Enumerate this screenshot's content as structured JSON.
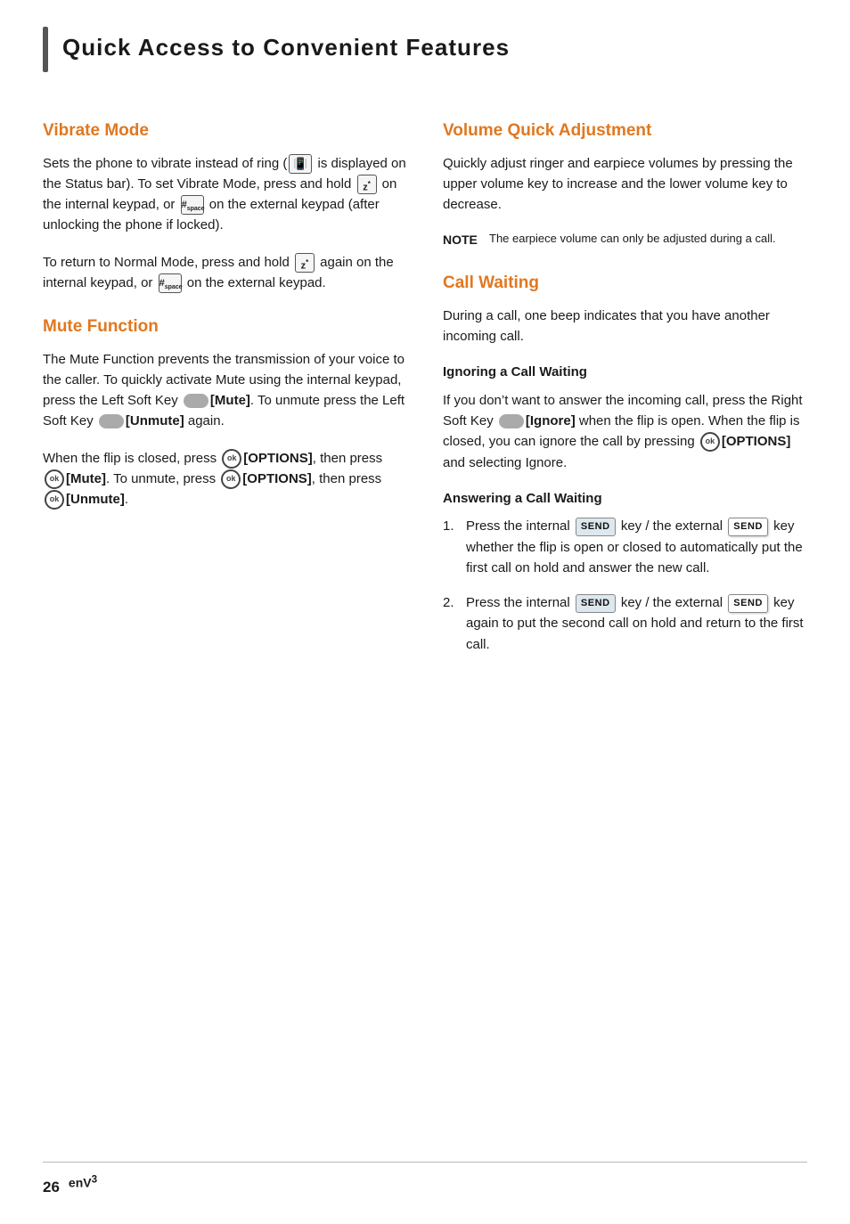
{
  "page": {
    "title": "Quick Access to Convenient Features",
    "accent_bar_visible": true
  },
  "left_col": {
    "vibrate_mode": {
      "title": "Vibrate Mode",
      "body1": "Sets the phone to vibrate instead of ring (",
      "body1b": " is displayed on the Status bar). To set Vibrate Mode, press and hold ",
      "body1c": " on the internal keypad, or ",
      "body1d": " on the external keypad (after unlocking the phone if locked).",
      "body2": "To return to Normal Mode, press and hold ",
      "body2b": " again on the internal keypad, or ",
      "body2c": " on the external keypad."
    },
    "mute_function": {
      "title": "Mute Function",
      "body1": "The Mute Function prevents the transmission of your voice to the caller. To quickly activate Mute using the internal keypad, press the Left Soft Key ",
      "mute_label": "[Mute]",
      "body2": ". To unmute press the Left Soft Key ",
      "unmute_label": "[Unmute]",
      "body3": " again.",
      "body4": "When the flip is closed, press ",
      "options_label": "[OPTIONS]",
      "body5": ", then press ",
      "mute_label2": "[Mute]",
      "body6": ". To unmute, press ",
      "options_label2": "[OPTIONS]",
      "body7": ", then press ",
      "unmute_label2": "[Unmute]",
      "body8": "."
    }
  },
  "right_col": {
    "volume_quick": {
      "title": "Volume Quick Adjustment",
      "body": "Quickly adjust ringer and earpiece volumes by pressing the upper volume key to increase and the lower volume key to decrease.",
      "note_label": "NOTE",
      "note_text": "The earpiece volume can only be adjusted during a call."
    },
    "call_waiting": {
      "title": "Call Waiting",
      "body": "During a call, one beep indicates that you have another incoming call.",
      "ignoring": {
        "title": "Ignoring a Call Waiting",
        "body1": "If you don’t want to answer the incoming call, press the Right Soft Key ",
        "ignore_label": "[Ignore]",
        "body2": " when the flip is open. When the flip is closed, you can ignore the call by pressing ",
        "options_label": "[OPTIONS]",
        "body3": " and selecting Ignore."
      },
      "answering": {
        "title": "Answering a Call Waiting",
        "items": [
          {
            "num": "1.",
            "text1": "Press the internal ",
            "send_label": "SEND",
            "text2": " key / the external ",
            "send_label2": "SEND",
            "text3": " key whether the flip is open or closed to automatically put the first call on hold and answer the new call."
          },
          {
            "num": "2.",
            "text1": "Press the internal ",
            "send_label": "SEND",
            "text2": " key / the external ",
            "send_label2": "SEND",
            "text3": " key again to put the second call on hold and return to the first call."
          }
        ]
      }
    }
  },
  "footer": {
    "page_number": "26",
    "brand": "enV",
    "brand_superscript": "3"
  },
  "icons": {
    "vibrate_icon": "📳",
    "z_key": "z*",
    "hash_key": "#space",
    "soft_key_shape": "—",
    "ok_key": "ok"
  }
}
